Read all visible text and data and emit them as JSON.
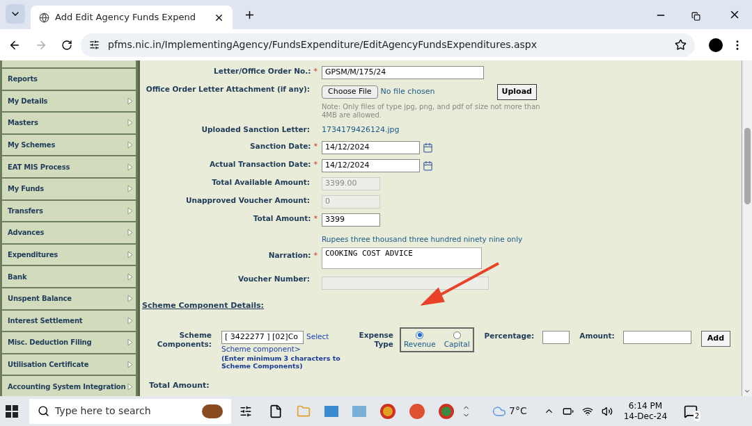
{
  "browser": {
    "tab_title": "Add Edit Agency Funds Expend",
    "url": "pfms.nic.in/ImplementingAgency/FundsExpenditure/EditAgencyFundsExpenditures.aspx"
  },
  "sidebar": {
    "items": [
      {
        "label": "Reports",
        "has_arrow": false
      },
      {
        "label": "My Details",
        "has_arrow": true
      },
      {
        "label": "Masters",
        "has_arrow": true
      },
      {
        "label": "My Schemes",
        "has_arrow": true
      },
      {
        "label": "EAT MIS Process",
        "has_arrow": true
      },
      {
        "label": "My Funds",
        "has_arrow": true
      },
      {
        "label": "Transfers",
        "has_arrow": true
      },
      {
        "label": "Advances",
        "has_arrow": true
      },
      {
        "label": "Expenditures",
        "has_arrow": true
      },
      {
        "label": "Bank",
        "has_arrow": true
      },
      {
        "label": "Unspent Balance",
        "has_arrow": true
      },
      {
        "label": "Interest Settlement",
        "has_arrow": true
      },
      {
        "label": "Misc. Deduction Filing",
        "has_arrow": true
      },
      {
        "label": "Utilisation Certificate",
        "has_arrow": true
      },
      {
        "label": "Accounting System Integration",
        "has_arrow": true
      }
    ]
  },
  "form": {
    "letter_no": {
      "label": "Letter/Office Order No.:",
      "value": "GPSM/M/175/24"
    },
    "attachment": {
      "label": "Office Order Letter Attachment (if any):",
      "choose": "Choose File",
      "status": "No file chosen",
      "upload": "Upload",
      "note": "Note: Only files of type jpg, png, and pdf of size not more than 4MB are allowed."
    },
    "uploaded": {
      "label": "Uploaded Sanction Letter:",
      "file": "1734179426124.jpg"
    },
    "sanction_date": {
      "label": "Sanction Date:",
      "value": "14/12/2024"
    },
    "transaction_date": {
      "label": "Actual Transaction Date:",
      "value": "14/12/2024"
    },
    "available": {
      "label": "Total Available Amount:",
      "value": "3399.00"
    },
    "unapproved": {
      "label": "Unapproved Voucher Amount:",
      "value": "0"
    },
    "total": {
      "label": "Total Amount:",
      "value": "3399",
      "words": "Rupees three thousand three hundred ninety nine only"
    },
    "narration": {
      "label": "Narration:",
      "value": "COOKING COST ADVICE"
    },
    "voucher": {
      "label": "Voucher Number:"
    },
    "required_mark": "*"
  },
  "scheme": {
    "heading": "Scheme Component Details:",
    "components_label": "Scheme Components:",
    "components_value": "[ 3422277 ] [02]Co",
    "select_link": "Select",
    "select_link2": "Scheme component>",
    "hint": "(Enter minimum 3 characters to Scheme Components)",
    "expense_label": "Expense Type",
    "options": [
      {
        "label": "Revenue",
        "selected": true
      },
      {
        "label": "Capital",
        "selected": false
      }
    ],
    "percentage_label": "Percentage:",
    "amount_label": "Amount:",
    "add": "Add",
    "total_label": "Total Amount:"
  },
  "taskbar": {
    "search_placeholder": "Type here to search",
    "weather": "7°C",
    "time": "6:14 PM",
    "date": "14-Dec-24",
    "notifications": "2"
  }
}
